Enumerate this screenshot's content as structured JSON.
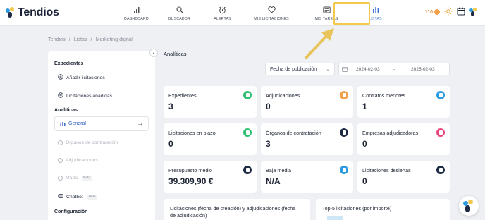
{
  "app": {
    "name": "Tendios"
  },
  "nav": [
    {
      "label": "DASHBOARD",
      "icon": "bar-chart-icon"
    },
    {
      "label": "BUSCADOR",
      "icon": "search-icon"
    },
    {
      "label": "ALERTAS",
      "icon": "alarm-clock-icon"
    },
    {
      "label": "MIS LICITACIONES",
      "icon": "heart-icon"
    },
    {
      "label": "MIS TAREAS",
      "icon": "notepad-icon"
    },
    {
      "label": "LISTAS",
      "icon": "list-bars-icon"
    }
  ],
  "top_right": {
    "coins": "110"
  },
  "breadcrumb": [
    "Tendios",
    "Listas",
    "Marketing digital"
  ],
  "sidebar": {
    "sections": {
      "expedientes": "Expedientes",
      "analiticas": "Analíticas",
      "configuracion": "Configuración"
    },
    "add_label": "Añadir licitaciones",
    "added_label": "Licitaciones añadidas",
    "general_label": "General",
    "organos_label": "Órganos de contratación",
    "adjudicaciones_label": "Adjudicaciones",
    "mapa_label": "Mapa",
    "chatbot_label": "Chatbot",
    "beta": "Beta"
  },
  "main": {
    "title": "Analíticas",
    "date_select": "Fecha de publicación",
    "date_from": "2024-02-03",
    "date_sep": "-",
    "date_to": "2025-02-03"
  },
  "cards": [
    {
      "title": "Expedientes",
      "value": "3",
      "color": "#2fbf71"
    },
    {
      "title": "Adjudicaciones",
      "value": "0",
      "color": "#f2a04a"
    },
    {
      "title": "Contratos menores",
      "value": "1",
      "color": "#2d9be0"
    },
    {
      "title": "Licitaciones en plazo",
      "value": "0",
      "color": "#2fbf71"
    },
    {
      "title": "Órganos de contratación",
      "value": "3",
      "color": "#1f2a44"
    },
    {
      "title": "Empresas adjudicadoras",
      "value": "0",
      "color": "#e8457a"
    },
    {
      "title": "Presupuesto medio",
      "value": "39.309,90 €",
      "color": "#1f2a44"
    },
    {
      "title": "Baja media",
      "value": "N/A",
      "color": "#2d9be0"
    },
    {
      "title": "Licitaciones desiertas",
      "value": "0",
      "color": "#1f2a44"
    }
  ],
  "bottom_panels": [
    {
      "title": "Licitaciones (fecha de creación) y adjudicaciones (fecha de adjudicación)"
    },
    {
      "title": "Top-5 licitaciones (por importe)"
    }
  ],
  "colors": {
    "accent": "#3b6fd6",
    "highlight": "#f2c94c",
    "background": "#eef0f3"
  }
}
